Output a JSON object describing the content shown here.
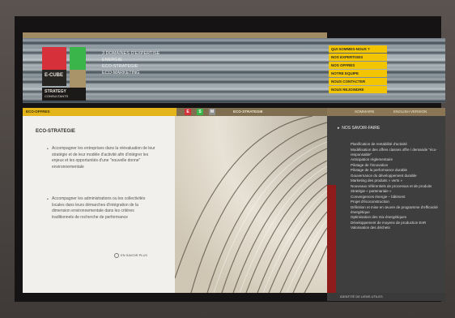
{
  "brand": {
    "logo_line1": "E-CUBE",
    "logo_line2": "STRATEGY",
    "logo_line3": "CONSULTANTS"
  },
  "tagline": {
    "lines": [
      "3 DOMAINES D'EXPERTISE",
      "ENERGIE",
      "ECO-STRATEGIE",
      "ECO-MARKETING"
    ]
  },
  "menu": {
    "items": [
      "QUI SOMMES-NOUS ?",
      "NOS EXPERTISES",
      "NOS OFFRES",
      "NOTRE EQUIPE",
      "NOUS CONTACTER",
      "NOUS REJOINDRE"
    ]
  },
  "subnav": {
    "left_label": "ECO-OFFRES",
    "mid_label": "ECO-STRATEGIE",
    "sq_e": "E",
    "sq_s": "S",
    "sq_m": "M",
    "right_link1": "SOMMAIRE",
    "right_link2": "ENGLISH VERSION"
  },
  "content": {
    "title": "ECO-STRATEGIE",
    "bullets": [
      "Accompagner les entreprises dans la réévaluation de leur stratégie et de leur modèle d'activité afin d'intégrer les enjeux et les opportunités d'une \"nouvelle donne\" environnementale",
      "Accompagner les administrations ou les collectivités locales dans leurs démarches d'intégration de la dimension environnementale dans les critères traditionnels de recherche de performance"
    ],
    "more_label": "EN SAVOIR PLUS"
  },
  "right_panel": {
    "title": "NOS SAVOIR-FAIRE",
    "items": [
      "Planification de rentabilité d'activité",
      "Modélisation des offres classes offre / demande \"éco-responsable\"",
      "Anticipation réglementaire",
      "Pilotage de l'innovation",
      "Pilotage de la performance durable",
      "Gouvernance du développement durable",
      "Marketing des produits « verts »",
      "Nouveaux référentiels de processus et de produits",
      "Stratégie « partenariale »",
      "Convergences énergie – bâtiment",
      "Projet d'écoconstruction",
      "Définition et mise en œuvre de programme d'efficacité énergétique",
      "Optimisation des mix énergétiques",
      "Développement de moyens de production EnR",
      "Valorisation des déchets"
    ]
  },
  "footer": {
    "text": "IDENTITÉ DE LIENS UTILES"
  },
  "colors": {
    "accent_yellow": "#f2c500",
    "brand_red": "#d6303a",
    "brand_green": "#39b54a",
    "brand_tan": "#a9946a"
  }
}
